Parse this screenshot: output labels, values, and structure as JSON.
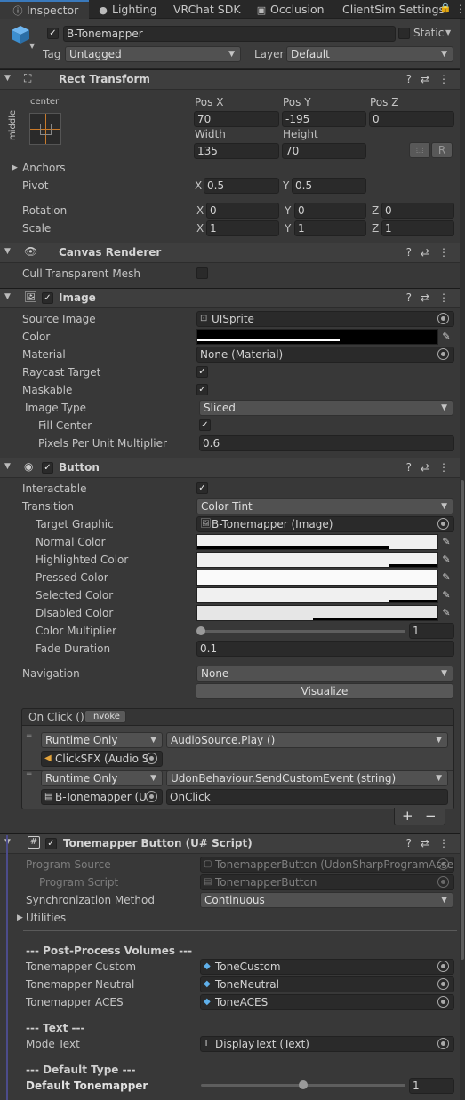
{
  "tabs": [
    {
      "label": "Inspector",
      "icon": "info-icon"
    },
    {
      "label": "Lighting",
      "icon": "lightbulb-icon"
    },
    {
      "label": "VRChat SDK",
      "icon": ""
    },
    {
      "label": "Occlusion",
      "icon": "occlusion-icon"
    },
    {
      "label": "ClientSim Settings",
      "icon": ""
    }
  ],
  "header": {
    "name": "B-Tonemapper",
    "static_label": "Static",
    "tag_label": "Tag",
    "tag_value": "Untagged",
    "layer_label": "Layer",
    "layer_value": "Default"
  },
  "rect_transform": {
    "title": "Rect Transform",
    "anchor_h": "center",
    "anchor_v": "middle",
    "pos_x_label": "Pos X",
    "pos_y_label": "Pos Y",
    "pos_z_label": "Pos Z",
    "pos_x": "70",
    "pos_y": "-195",
    "pos_z": "0",
    "width_label": "Width",
    "height_label": "Height",
    "width": "135",
    "height": "70",
    "r_button": "R",
    "anchors_label": "Anchors",
    "pivot_label": "Pivot",
    "pivot_x": "0.5",
    "pivot_y": "0.5",
    "rotation_label": "Rotation",
    "rot_x": "0",
    "rot_y": "0",
    "rot_z": "0",
    "scale_label": "Scale",
    "scale_x": "1",
    "scale_y": "1",
    "scale_z": "1",
    "x": "X",
    "y": "Y",
    "z": "Z"
  },
  "canvas_renderer": {
    "title": "Canvas Renderer",
    "cull_label": "Cull Transparent Mesh"
  },
  "image": {
    "title": "Image",
    "source_label": "Source Image",
    "source_value": "UISprite",
    "color_label": "Color",
    "material_label": "Material",
    "material_value": "None (Material)",
    "raycast_label": "Raycast Target",
    "maskable_label": "Maskable",
    "type_label": "Image Type",
    "type_value": "Sliced",
    "fill_label": "Fill Center",
    "ppu_label": "Pixels Per Unit Multiplier",
    "ppu_value": "0.6"
  },
  "button": {
    "title": "Button",
    "interactable_label": "Interactable",
    "transition_label": "Transition",
    "transition_value": "Color Tint",
    "target_label": "Target Graphic",
    "target_value": "B-Tonemapper (Image)",
    "normal_label": "Normal Color",
    "highlighted_label": "Highlighted Color",
    "pressed_label": "Pressed Color",
    "selected_label": "Selected Color",
    "disabled_label": "Disabled Color",
    "multiplier_label": "Color Multiplier",
    "multiplier_value": "1",
    "fade_label": "Fade Duration",
    "fade_value": "0.1",
    "nav_label": "Navigation",
    "nav_value": "None",
    "visualize_label": "Visualize",
    "onclick_label": "On Click ()",
    "invoke_label": "Invoke",
    "events": [
      {
        "mode": "Runtime Only",
        "function": "AudioSource.Play ()",
        "object": "ClickSFX (Audio S",
        "arg": ""
      },
      {
        "mode": "Runtime Only",
        "function": "UdonBehaviour.SendCustomEvent (string)",
        "object": "B-Tonemapper (U",
        "arg": "OnClick"
      }
    ],
    "plus": "+",
    "minus": "−"
  },
  "script": {
    "title": "Tonemapper Button (U# Script)",
    "program_source_label": "Program Source",
    "program_source_value": "TonemapperButton (UdonSharpProgramAsse",
    "program_script_label": "Program Script",
    "program_script_value": "TonemapperButton",
    "sync_label": "Synchronization Method",
    "sync_value": "Continuous",
    "utilities_label": "Utilities",
    "ppv_header": "--- Post-Process Volumes ---",
    "custom_label": "Tonemapper Custom",
    "custom_value": "ToneCustom",
    "neutral_label": "Tonemapper Neutral",
    "neutral_value": "ToneNeutral",
    "aces_label": "Tonemapper ACES",
    "aces_value": "ToneACES",
    "text_header": "--- Text ---",
    "mode_text_label": "Mode Text",
    "mode_text_value": "DisplayText (Text)",
    "default_header": "--- Default Type ---",
    "default_label": "Default Tonemapper",
    "default_value": "1"
  },
  "colors": {
    "accent": "#3a79bb",
    "panel": "#383838",
    "field": "#2a2a2a"
  }
}
